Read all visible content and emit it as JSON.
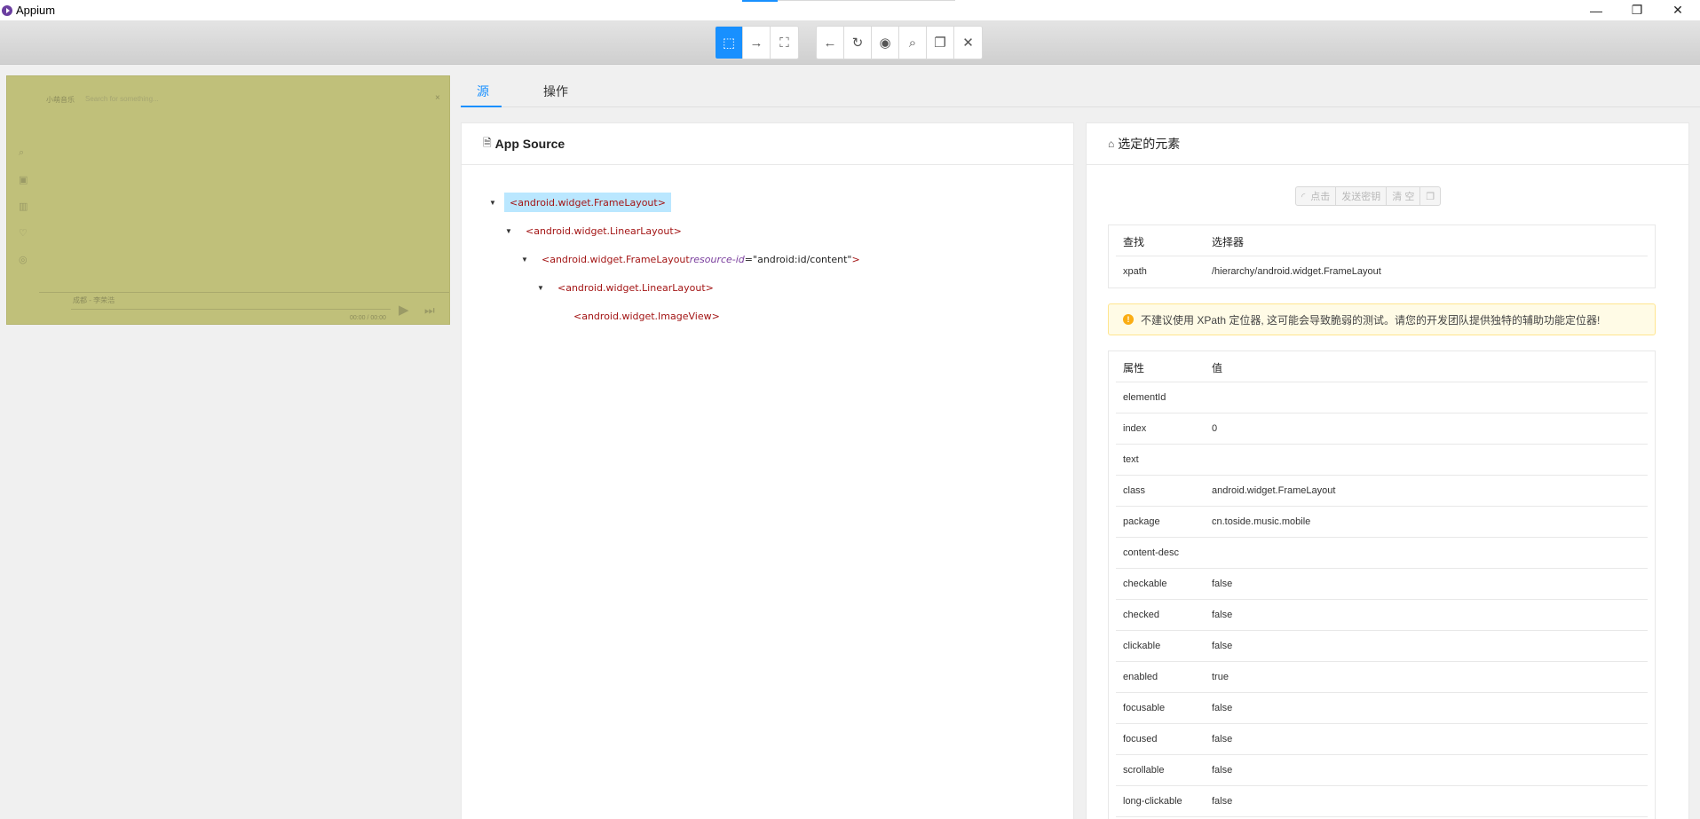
{
  "window": {
    "title": "Appium"
  },
  "toolbar": {
    "group1": [
      {
        "name": "select-element-icon",
        "glyph": "⬚",
        "active": true
      },
      {
        "name": "swipe-by-coordinates-icon",
        "glyph": "→",
        "active": false
      },
      {
        "name": "tap-by-coordinates-icon",
        "glyph": "⛶",
        "active": false
      }
    ],
    "group2": [
      {
        "name": "back-icon",
        "glyph": "←"
      },
      {
        "name": "refresh-icon",
        "glyph": "↻"
      },
      {
        "name": "eye-icon",
        "glyph": "◉"
      },
      {
        "name": "search-icon",
        "glyph": "⌕"
      },
      {
        "name": "copy-icon",
        "glyph": "❐"
      },
      {
        "name": "close-icon",
        "glyph": "✕"
      }
    ]
  },
  "device": {
    "app_name": "小萌音乐",
    "search_placeholder": "Search for something...",
    "close": "×",
    "song": "成都 - 李荣浩",
    "time": "00:00 / 00:00",
    "sidebar_icons": [
      "⌕",
      "▣",
      "▥",
      "♡",
      "◎"
    ],
    "play": "▶",
    "next": "⏭"
  },
  "tabs": {
    "source": "源",
    "actions": "操作"
  },
  "source_panel": {
    "title": "App Source",
    "icon": "🗎",
    "nodes": [
      {
        "text": "<android.widget.FrameLayout>",
        "selected": true,
        "caret": true
      },
      {
        "text": "<android.widget.LinearLayout>",
        "caret": true
      },
      {
        "text_prefix": "<android.widget.FrameLayout ",
        "attr_name": "resource-id",
        "attr_eq": "=",
        "attr_value": "\"android:id/content\"",
        "text_suffix": ">",
        "caret": true
      },
      {
        "text": "<android.widget.LinearLayout>",
        "caret": true
      },
      {
        "text": "<android.widget.ImageView>",
        "caret": false
      }
    ]
  },
  "selected_panel": {
    "title": "选定的元素",
    "icon": "⌂",
    "actions": [
      "点击",
      "发送密钥",
      "清 空",
      "❐"
    ],
    "action_icon": "◜",
    "selector_table": {
      "headers": [
        "查找",
        "选择器"
      ],
      "rows": [
        [
          "xpath",
          "/hierarchy/android.widget.FrameLayout"
        ]
      ]
    },
    "warning": "不建议使用 XPath 定位器, 这可能会导致脆弱的测试。请您的开发团队提供独特的辅助功能定位器!",
    "warning_icon": "!",
    "attr_table": {
      "headers": [
        "属性",
        "值"
      ],
      "rows": [
        [
          "elementId",
          ""
        ],
        [
          "index",
          "0"
        ],
        [
          "text",
          ""
        ],
        [
          "class",
          "android.widget.FrameLayout"
        ],
        [
          "package",
          "cn.toside.music.mobile"
        ],
        [
          "content-desc",
          ""
        ],
        [
          "checkable",
          "false"
        ],
        [
          "checked",
          "false"
        ],
        [
          "clickable",
          "false"
        ],
        [
          "enabled",
          "true"
        ],
        [
          "focusable",
          "false"
        ],
        [
          "focused",
          "false"
        ],
        [
          "scrollable",
          "false"
        ],
        [
          "long-clickable",
          "false"
        ]
      ]
    }
  },
  "colors": {
    "accent": "#1890ff",
    "device_overlay": "#c0c07a",
    "selected_node": "#bae7ff",
    "warning_bg": "#fffbe6"
  }
}
